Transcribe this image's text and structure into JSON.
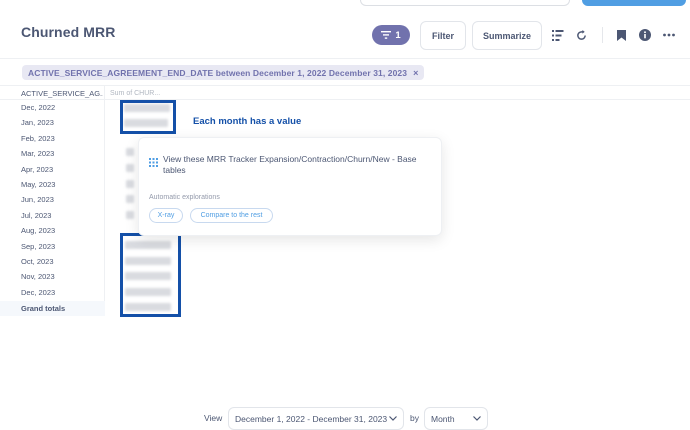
{
  "header": {
    "title": "Churned MRR",
    "filter_count": "1",
    "filter_label": "Filter",
    "summarize_label": "Summarize"
  },
  "filter_chip": {
    "text": "ACTIVE_SERVICE_AGREEMENT_END_DATE between December 1, 2022 December 31, 2023",
    "remove": "×"
  },
  "table": {
    "row_header": "ACTIVE_SERVICE_AG...",
    "value_header": "Sum of CHUR...",
    "rows": [
      "Dec, 2022",
      "Jan, 2023",
      "Feb, 2023",
      "Mar, 2023",
      "Apr, 2023",
      "May, 2023",
      "Jun, 2023",
      "Jul, 2023",
      "Aug, 2023",
      "Sep, 2023",
      "Oct, 2023",
      "Nov, 2023",
      "Dec, 2023"
    ],
    "total_label": "Grand totals"
  },
  "annotation": {
    "text": "Each month has a value",
    "color": "#1450a8"
  },
  "popover": {
    "title": "View these MRR Tracker Expansion/Contraction/Churn/New - Base tables",
    "subtitle": "Automatic explorations",
    "xray": "X-ray",
    "compare": "Compare to the rest"
  },
  "footer": {
    "view_label": "View",
    "date_range": "December 1, 2022 - December 31, 2023",
    "by_label": "by",
    "granularity": "Month"
  },
  "colors": {
    "accent": "#509ee3",
    "filter": "#7172ad",
    "text": "#4c5773"
  }
}
